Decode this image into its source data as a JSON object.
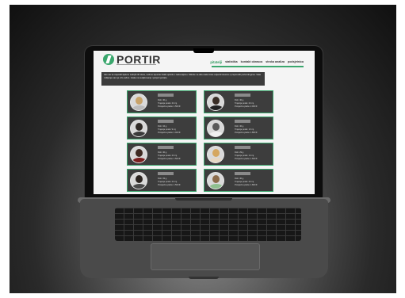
{
  "site": {
    "logo": "PORTIR",
    "nav": [
      "pitatelji",
      "statistika",
      "kontakt obrasca",
      "stroka analiza",
      "podsjetnica"
    ],
    "intro": "Ako ste se zaposlili tijekom zadnjih 30 dana, molimo ispunite kratki upitnik o zadovoljstvu. Kliknite na sliku kako biste ocijenili iskustvo i preporučili portal drugima. Vaše mišljenje nam je vrlo važno. Hvala na sudjelovanju i potpori portalu."
  },
  "cards": [
    {
      "stats": [
        "Dob: 40 g.",
        "Trajanje posla: 24 mj.",
        "Prosječna plaća: 1.500 €"
      ],
      "colors": {
        "hair": "#c8a36a",
        "shirt": "#bbb"
      }
    },
    {
      "stats": [
        "Dob: 40 g.",
        "Trajanje posla: 24 mj.",
        "Prosječna plaća: 2.000 €"
      ],
      "colors": {
        "hair": "#3a2e26",
        "shirt": "#222"
      }
    },
    {
      "stats": [
        "Dob: 34 g.",
        "Trajanje posla: 9 mj.",
        "Prosječna plaća: 1.400 €"
      ],
      "colors": {
        "hair": "#2f2a26",
        "shirt": "#3a3a3a"
      }
    },
    {
      "stats": [
        "Dob: 40 g.",
        "Trajanje posla: 13 mj.",
        "Prosječna plaća: 1.800 €"
      ],
      "colors": {
        "hair": "#5a5a5a",
        "shirt": "#f0f0f0"
      }
    },
    {
      "stats": [
        "Dob: 40 g.",
        "Trajanje posla: 24 mj.",
        "Prosječna plaća: 1.500 €"
      ],
      "colors": {
        "hair": "#3e2a22",
        "shirt": "#7a1f1f"
      }
    },
    {
      "stats": [
        "Dob: 29 g.",
        "Trajanje posla: 14 mj.",
        "Prosječna plaća: 1.600 €"
      ],
      "colors": {
        "hair": "#d5a760",
        "shirt": "#e6d7c3"
      }
    },
    {
      "stats": [
        "Dob: 33 g.",
        "Trajanje posla: 24 mj.",
        "Prosječna plaća: 1.500 €"
      ],
      "colors": {
        "hair": "#2b2420",
        "shirt": "#4a4a4a"
      }
    },
    {
      "stats": [
        "Dob: 40 g.",
        "Trajanje posla: 24 mj.",
        "Prosječna plaća: 1.800 €"
      ],
      "colors": {
        "hair": "#8b6b4a",
        "shirt": "#8fbf8f"
      }
    }
  ],
  "colors": {
    "accent": "#3aa76d",
    "card_bg": "#3d3d3d",
    "intro_bg": "#3b3b3b"
  }
}
